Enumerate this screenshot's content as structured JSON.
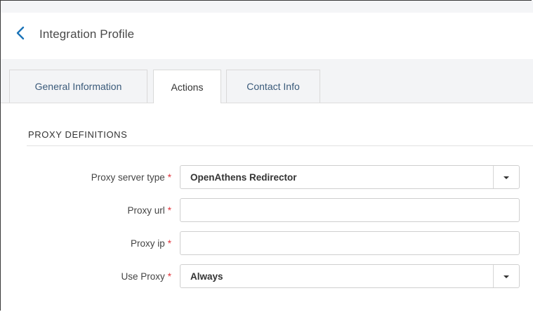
{
  "header": {
    "title": "Integration Profile",
    "back_icon": "chevron-left-icon",
    "accent": "#1a73b8"
  },
  "tabs": [
    {
      "label": "General Information",
      "active": false
    },
    {
      "label": "Actions",
      "active": true
    },
    {
      "label": "Contact Info",
      "active": false
    }
  ],
  "section": {
    "title": "PROXY DEFINITIONS"
  },
  "form": {
    "required_mark": "*",
    "required_color": "#e2323a",
    "proxy_server_type": {
      "label": "Proxy server type",
      "value": "OpenAthens Redirector"
    },
    "proxy_url": {
      "label": "Proxy url",
      "value": ""
    },
    "proxy_ip": {
      "label": "Proxy ip",
      "value": ""
    },
    "use_proxy": {
      "label": "Use Proxy",
      "value": "Always"
    }
  }
}
